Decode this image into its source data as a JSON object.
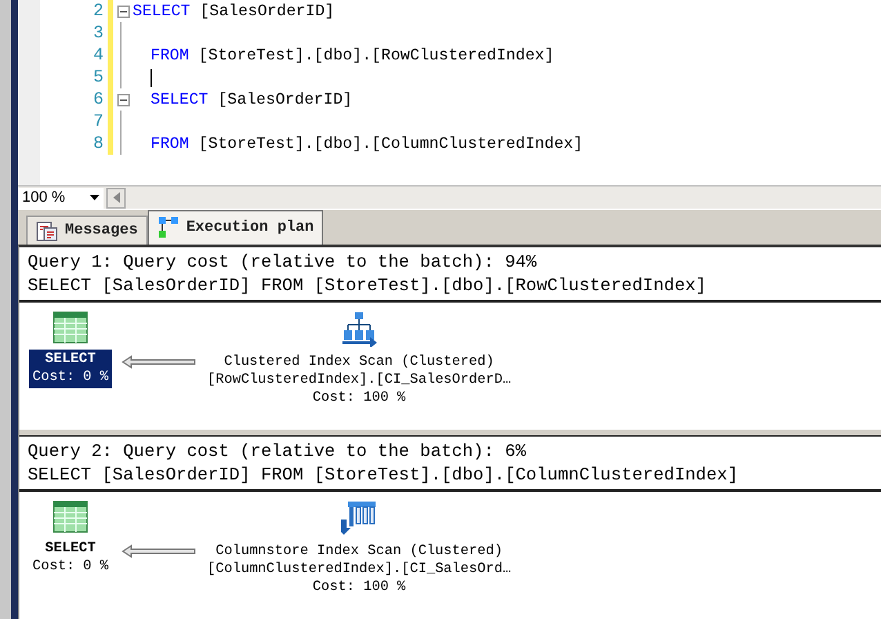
{
  "editor": {
    "lines": [
      {
        "number": "2",
        "fold": true,
        "indented": false,
        "caret": false,
        "keyword": "SELECT",
        "text": " [SalesOrderID]"
      },
      {
        "number": "3",
        "fold": false,
        "indented": false,
        "caret": false
      },
      {
        "number": "4",
        "fold": false,
        "indented": true,
        "caret": false,
        "keyword": "FROM",
        "text": " [StoreTest].[dbo].[RowClusteredIndex]"
      },
      {
        "number": "5",
        "fold": false,
        "indented": true,
        "caret": true
      },
      {
        "number": "6",
        "fold": true,
        "indented": true,
        "caret": false,
        "keyword": "SELECT",
        "text": " [SalesOrderID]"
      },
      {
        "number": "7",
        "fold": false,
        "indented": false,
        "caret": false
      },
      {
        "number": "8",
        "fold": false,
        "indented": true,
        "caret": false,
        "keyword": "FROM",
        "text": " [StoreTest].[dbo].[ColumnClusteredIndex]"
      }
    ]
  },
  "zoom": "100 %",
  "tabs": [
    {
      "label": "Messages",
      "kind": "messages",
      "selected": false
    },
    {
      "label": "Execution plan",
      "kind": "plan",
      "selected": true
    }
  ],
  "queries": [
    {
      "header": "Query 1: Query cost (relative to the batch): 94%",
      "statement": "SELECT [SalesOrderID] FROM [StoreTest].[dbo].[RowClusteredIndex]",
      "nodes": [
        {
          "kind": "select",
          "selected": true,
          "lines": [
            "SELECT",
            "Cost: 0 %"
          ]
        },
        {
          "kind": "clustered-scan",
          "selected": false,
          "lines": [
            "Clustered Index Scan (Clustered)",
            "[RowClusteredIndex].[CI_SalesOrderD…",
            "Cost: 100 %"
          ]
        }
      ]
    },
    {
      "header": "Query 2: Query cost (relative to the batch): 6%",
      "statement": "SELECT [SalesOrderID] FROM [StoreTest].[dbo].[ColumnClusteredIndex]",
      "nodes": [
        {
          "kind": "select",
          "selected": false,
          "lines": [
            "SELECT",
            "Cost: 0 %"
          ]
        },
        {
          "kind": "columnstore-scan",
          "selected": false,
          "lines": [
            "Columnstore Index Scan (Clustered)",
            "[ColumnClusteredIndex].[CI_SalesOrd…",
            "Cost: 100 %"
          ]
        }
      ]
    }
  ]
}
